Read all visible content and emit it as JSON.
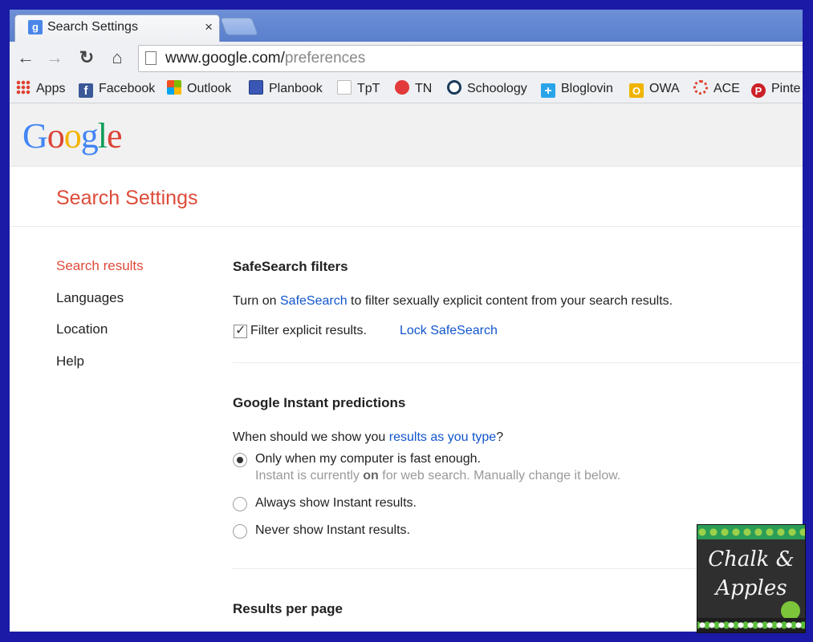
{
  "tab": {
    "favicon": "g-favicon",
    "title": "Search Settings",
    "close": "×"
  },
  "toolbar": {
    "back": "←",
    "forward": "→",
    "reload": "↻",
    "home": "⌂",
    "url_host": "www.google.com/",
    "url_path": "preferences"
  },
  "bookmarks": [
    {
      "label": "Apps",
      "icon": "apps-grid-icon",
      "color": "#e0412f"
    },
    {
      "label": "Facebook",
      "icon": "facebook-icon",
      "color": "#3b5998"
    },
    {
      "label": "Outlook",
      "icon": "windows-logo-icon",
      "color": "#f25022"
    },
    {
      "label": "Planbook",
      "icon": "planbook-icon",
      "color": "#3a57b5"
    },
    {
      "label": "TpT",
      "icon": "tpt-icon",
      "color": "#2d9b4e"
    },
    {
      "label": "TN",
      "icon": "apple-icon",
      "color": "#e23a3a"
    },
    {
      "label": "Schoology",
      "icon": "schoology-icon",
      "color": "#1a6fb3"
    },
    {
      "label": "Bloglovin",
      "icon": "bloglovin-icon",
      "color": "#2aa4e8"
    },
    {
      "label": "OWA",
      "icon": "owa-icon",
      "color": "#f0b400"
    },
    {
      "label": "ACE",
      "icon": "ace-icon",
      "color": "#e0412f"
    },
    {
      "label": "Pinte",
      "icon": "pinterest-icon",
      "color": "#cb2027"
    }
  ],
  "logo": [
    "G",
    "o",
    "o",
    "g",
    "l",
    "e"
  ],
  "page_title": "Search Settings",
  "nav": [
    "Search results",
    "Languages",
    "Location",
    "Help"
  ],
  "safesearch": {
    "title": "SafeSearch filters",
    "desc_pre": "Turn on ",
    "desc_link": "SafeSearch",
    "desc_post": " to filter sexually explicit content from your search results.",
    "checkbox_label": "Filter explicit results.",
    "checkbox_checked": true,
    "lock_link": "Lock SafeSearch"
  },
  "instant": {
    "title": "Google Instant predictions",
    "question_pre": "When should we show you ",
    "question_link": "results as you type",
    "question_post": "?",
    "options": [
      {
        "label": "Only when my computer is fast enough.",
        "selected": true
      },
      {
        "label": "Always show Instant results.",
        "selected": false
      },
      {
        "label": "Never show Instant results.",
        "selected": false
      }
    ],
    "note_pre": "Instant is currently ",
    "note_bold": "on",
    "note_post": " for web search. Manually change it below."
  },
  "results_per_page": {
    "title": "Results per page"
  },
  "badge": {
    "line1": "Chalk &",
    "line2": "Apples"
  },
  "colors": {
    "frame": "#1a1aa6",
    "accent_red": "#dd4b39",
    "link_blue": "#1155cc"
  }
}
